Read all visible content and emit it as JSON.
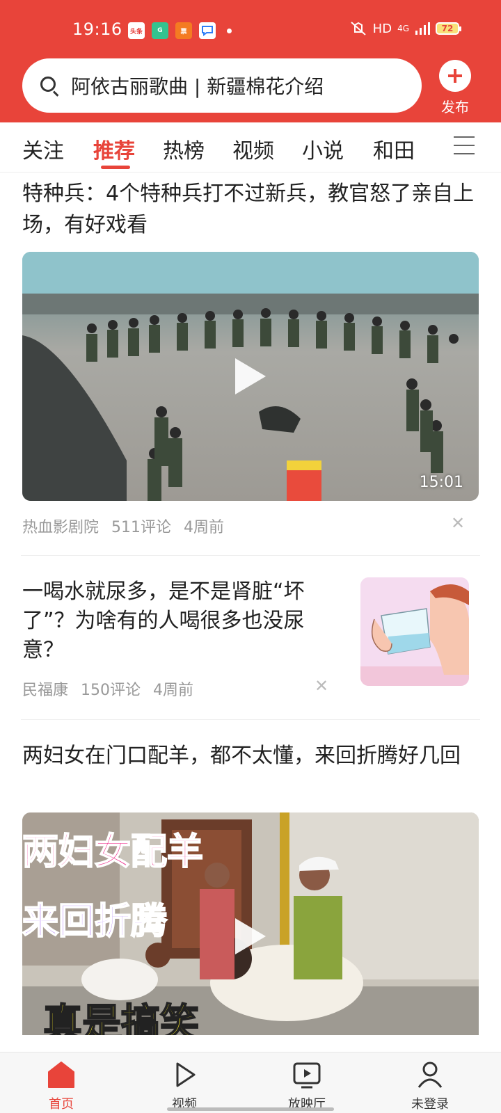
{
  "status_bar": {
    "time": "19:16",
    "notif_icons": [
      "头条",
      "G",
      "票",
      "chat"
    ],
    "network": "HD",
    "signal": "4G",
    "battery": "72"
  },
  "header": {
    "search_text": "阿依古丽歌曲 | 新疆棉花介绍",
    "publish_label": "发布"
  },
  "tabs": [
    {
      "label": "关注"
    },
    {
      "label": "推荐"
    },
    {
      "label": "热榜"
    },
    {
      "label": "视频"
    },
    {
      "label": "小说"
    },
    {
      "label": "和田"
    }
  ],
  "feed": [
    {
      "title": "特种兵：4个特种兵打不过新兵，教官怒了亲自上场，有好戏看",
      "duration": "15:01",
      "source": "热血影剧院",
      "comments": "511评论",
      "time": "4周前"
    },
    {
      "title": "一喝水就尿多，是不是肾脏“坏了”？为啥有的人喝很多也没尿意？",
      "source": "民福康",
      "comments": "150评论",
      "time": "4周前"
    },
    {
      "title": "两妇女在门口配羊，都不太懂，来回折腾好几回",
      "overlay_lines": [
        "两妇女配羊",
        "来回折腾",
        "真是搞笑"
      ]
    }
  ],
  "bottom_nav": [
    {
      "label": "首页"
    },
    {
      "label": "视频"
    },
    {
      "label": "放映厅"
    },
    {
      "label": "未登录"
    }
  ],
  "colors": {
    "accent": "#e8443a"
  }
}
